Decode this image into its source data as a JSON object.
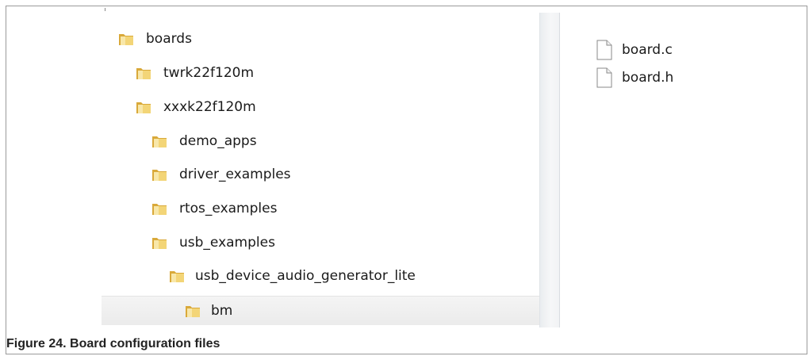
{
  "tree": {
    "items": [
      {
        "label": "boards",
        "depth": 0,
        "selected": false
      },
      {
        "label": "twrk22f120m",
        "depth": 1,
        "selected": false
      },
      {
        "label": "xxxk22f120m",
        "depth": 1,
        "selected": false
      },
      {
        "label": "demo_apps",
        "depth": 2,
        "selected": false
      },
      {
        "label": "driver_examples",
        "depth": 2,
        "selected": false
      },
      {
        "label": "rtos_examples",
        "depth": 2,
        "selected": false
      },
      {
        "label": "usb_examples",
        "depth": 2,
        "selected": false
      },
      {
        "label": "usb_device_audio_generator_lite",
        "depth": 3,
        "selected": false
      },
      {
        "label": "bm",
        "depth": 4,
        "selected": true
      }
    ]
  },
  "files": {
    "items": [
      {
        "name": "board.c",
        "icon": "file-icon"
      },
      {
        "name": "board.h",
        "icon": "file-icon"
      }
    ]
  },
  "caption": {
    "text": "Figure 24.  Board configuration files"
  },
  "colors": {
    "folder_light": "#f6dd86",
    "folder_dark": "#d9a93a",
    "selection": "#ebebeb"
  }
}
